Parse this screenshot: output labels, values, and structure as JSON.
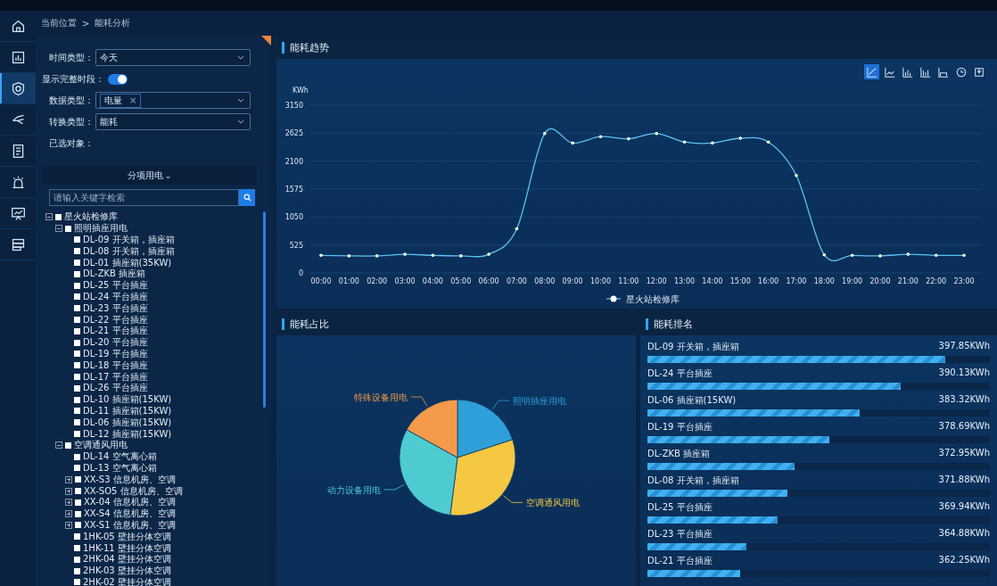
{
  "nav": [
    {
      "kind": "home",
      "selected": false
    },
    {
      "kind": "report",
      "selected": false
    },
    {
      "kind": "shield",
      "selected": true
    },
    {
      "kind": "branch",
      "selected": false
    },
    {
      "kind": "document",
      "selected": false
    },
    {
      "kind": "alarm",
      "selected": false
    },
    {
      "kind": "monitor",
      "selected": false
    },
    {
      "kind": "database",
      "selected": false
    }
  ],
  "breadcrumb": {
    "label": "当前位置",
    "separator": ">",
    "current": "能耗分析"
  },
  "filters": {
    "time_type": {
      "label": "时间类型：",
      "value": "今天"
    },
    "full_period": {
      "label": "显示完整时段：",
      "on": true
    },
    "data_type": {
      "label": "数据类型：",
      "tag": "电量",
      "remove": "×"
    },
    "convert_type": {
      "label": "转换类型：",
      "value": "能耗"
    },
    "selected_objects": {
      "label": "已选对象："
    }
  },
  "category_dropdown": {
    "label": "分项用电",
    "caret": "⌄"
  },
  "search": {
    "placeholder": "请输入关键字检索"
  },
  "tree": [
    {
      "label": "星火站检修库",
      "checked": false,
      "expanded": true,
      "children": [
        {
          "label": "照明插座用电",
          "checked": false,
          "expanded": true,
          "children": [
            {
              "label": "DL-09 开关箱，插座箱",
              "checked": false
            },
            {
              "label": "DL-08 开关箱，插座箱",
              "checked": false
            },
            {
              "label": "DL-01 插座箱(35KW)",
              "checked": false
            },
            {
              "label": "DL-ZKB 插座箱",
              "checked": false
            },
            {
              "label": "DL-25 平台插座",
              "checked": false
            },
            {
              "label": "DL-24 平台插座",
              "checked": false
            },
            {
              "label": "DL-23 平台插座",
              "checked": false
            },
            {
              "label": "DL-22 平台插座",
              "checked": false
            },
            {
              "label": "DL-21 平台插座",
              "checked": false
            },
            {
              "label": "DL-20 平台插座",
              "checked": false
            },
            {
              "label": "DL-19 平台插座",
              "checked": false
            },
            {
              "label": "DL-18 平台插座",
              "checked": false
            },
            {
              "label": "DL-17 平台插座",
              "checked": false
            },
            {
              "label": "DL-26 平台插座",
              "checked": false
            },
            {
              "label": "DL-10 插座箱(15KW)",
              "checked": false
            },
            {
              "label": "DL-11 插座箱(15KW)",
              "checked": false
            },
            {
              "label": "DL-06 插座箱(15KW)",
              "checked": false
            },
            {
              "label": "DL-12 插座箱(15KW)",
              "checked": false
            }
          ]
        },
        {
          "label": "空调通风用电",
          "checked": false,
          "expanded": true,
          "children": [
            {
              "label": "DL-14 空气离心箱",
              "checked": false
            },
            {
              "label": "DL-13 空气离心箱",
              "checked": false
            },
            {
              "label": "XX-S3 信息机房、空调",
              "checked": false,
              "expanded": false
            },
            {
              "label": "XX-SO5 信息机房、空调",
              "checked": false,
              "expanded": false
            },
            {
              "label": "XX-04 信息机房、空调",
              "checked": false,
              "expanded": false
            },
            {
              "label": "XX-S4 信息机房、空调",
              "checked": false,
              "expanded": false
            },
            {
              "label": "XX-S1 信息机房、空调",
              "checked": false,
              "expanded": false
            },
            {
              "label": "1HK-05 壁挂分体空调",
              "checked": false
            },
            {
              "label": "1HK-11 壁挂分体空调",
              "checked": false
            },
            {
              "label": "2HK-04 壁挂分体空调",
              "checked": false
            },
            {
              "label": "2HK-03 壁挂分体空调",
              "checked": false
            },
            {
              "label": "2HK-02 壁挂分体空调",
              "checked": false
            }
          ]
        }
      ]
    }
  ],
  "trend": {
    "title": "能耗趋势",
    "tools": [
      {
        "kind": "line",
        "selected": true
      },
      {
        "kind": "area",
        "selected": false
      },
      {
        "kind": "bar",
        "selected": false
      },
      {
        "kind": "stack",
        "selected": false
      },
      {
        "kind": "tiled",
        "selected": false
      },
      {
        "kind": "clock",
        "selected": false
      },
      {
        "kind": "save",
        "selected": false
      }
    ],
    "chart_data": {
      "type": "line",
      "ylabel": "KWh",
      "categories": [
        "00:00",
        "01:00",
        "02:00",
        "03:00",
        "04:00",
        "05:00",
        "06:00",
        "07:00",
        "08:00",
        "09:00",
        "10:00",
        "11:00",
        "12:00",
        "13:00",
        "14:00",
        "15:00",
        "16:00",
        "17:00",
        "18:00",
        "19:00",
        "20:00",
        "21:00",
        "22:00",
        "23:00"
      ],
      "series": [
        {
          "name": "星火站检修库",
          "color": "#5cc3f0",
          "values": [
            330,
            320,
            320,
            350,
            330,
            320,
            350,
            830,
            2620,
            2440,
            2560,
            2520,
            2620,
            2460,
            2440,
            2530,
            2460,
            1830,
            340,
            330,
            320,
            350,
            330,
            330
          ]
        }
      ],
      "ylim": [
        0,
        3150
      ],
      "yticks": [
        0,
        525,
        1050,
        1575,
        2100,
        2625,
        3150
      ],
      "grid": true
    }
  },
  "share": {
    "title": "能耗占比",
    "chart_data": {
      "type": "pie",
      "categories": [
        "照明插座用电",
        "空调通风用电",
        "动力设备用电",
        "特殊设备用电"
      ],
      "values": [
        20,
        32,
        31,
        17
      ],
      "colors": [
        "#2e9fd8",
        "#f5c842",
        "#4ecbd0",
        "#f59a4a"
      ]
    }
  },
  "ranking": {
    "title": "能耗排名",
    "rows": [
      {
        "name": "DL-09 开关箱，插座箱",
        "value": "397.85KWh",
        "level": 0.87
      },
      {
        "name": "DL-24 平台插座",
        "value": "390.13KWh",
        "level": 0.74
      },
      {
        "name": "DL-06 插座箱(15KW)",
        "value": "383.32KWh",
        "level": 0.62
      },
      {
        "name": "DL-19 平台插座",
        "value": "378.69KWh",
        "level": 0.53
      },
      {
        "name": "DL-ZKB 插座箱",
        "value": "372.95KWh",
        "level": 0.43
      },
      {
        "name": "DL-08 开关箱，插座箱",
        "value": "371.88KWh",
        "level": 0.41
      },
      {
        "name": "DL-25 平台插座",
        "value": "369.94KWh",
        "level": 0.38
      },
      {
        "name": "DL-23 平台插座",
        "value": "364.88KWh",
        "level": 0.29
      },
      {
        "name": "DL-21 平台插座",
        "value": "362.25KWh",
        "level": 0.27
      }
    ]
  }
}
